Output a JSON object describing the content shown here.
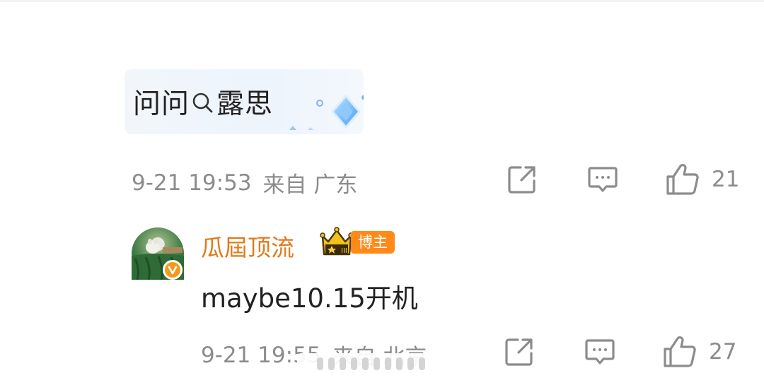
{
  "ai_ask": {
    "prefix": "问问",
    "keyword": "露思",
    "icon": "search-icon"
  },
  "comment": {
    "time": "9-21 19:53",
    "location": "来自 广东",
    "like_count": "21"
  },
  "reply": {
    "username": "瓜屆顶流",
    "badge_label": "博主",
    "text": "maybe10.15开机",
    "time": "9-21 19:55",
    "location": "来自 北京",
    "like_count": "27"
  },
  "colors": {
    "meta_gray": "#8c8c8c",
    "username_orange": "#e07b1a",
    "badge_orange": "#ff8a1a"
  }
}
